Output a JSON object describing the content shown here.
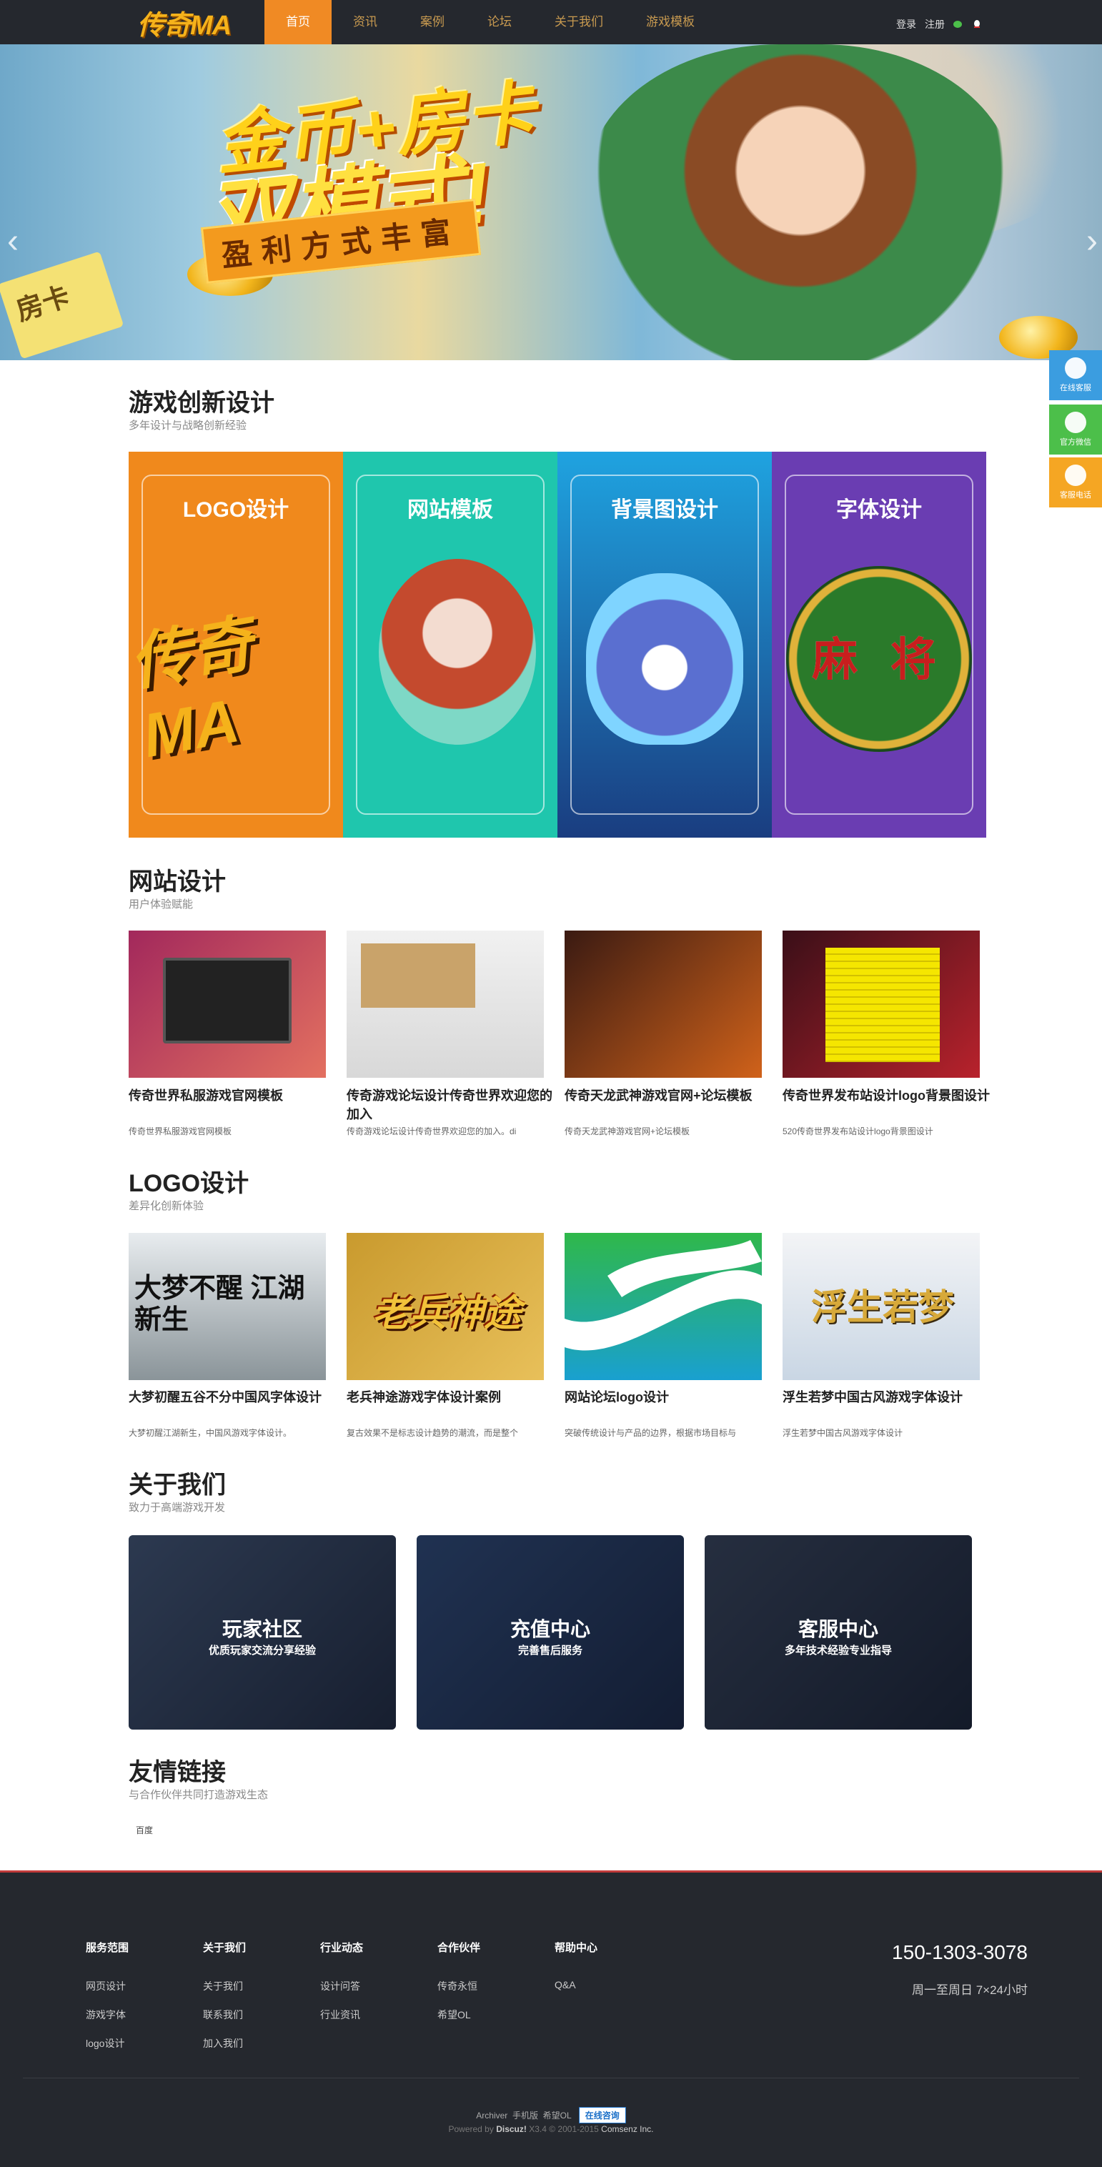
{
  "header": {
    "logo": "传奇MA",
    "nav": [
      "首页",
      "资讯",
      "案例",
      "论坛",
      "关于我们",
      "游戏模板"
    ],
    "login": "登录",
    "register": "注册"
  },
  "banner": {
    "line1": "金币+房卡",
    "line2": "双模式!",
    "line3": "盈利方式丰富",
    "card": "房卡"
  },
  "section1": {
    "title": "游戏创新设计",
    "subtitle": "多年设计与战略创新经验",
    "panels": [
      {
        "label": "LOGO设计",
        "color": "#f0891c",
        "inner": "传奇MA"
      },
      {
        "label": "网站模板",
        "color": "#1fc6ad",
        "inner": ""
      },
      {
        "label": "背景图设计",
        "color": "#1a76c8",
        "inner": ""
      },
      {
        "label": "字体设计",
        "color": "#6a3db2",
        "inner": "麻 将"
      }
    ]
  },
  "section2": {
    "title": "网站设计",
    "subtitle": "用户体验赋能",
    "items": [
      {
        "title": "传奇世界私服游戏官网模板",
        "desc": "传奇世界私服游戏官网模板",
        "bg": "linear-gradient(135deg,#a2285c,#e37060)"
      },
      {
        "title": "传奇游戏论坛设计传奇世界欢迎您的加入",
        "desc": "传奇游戏论坛设计传奇世界欢迎您的加入。di",
        "bg": "linear-gradient(180deg,#f1f1f1,#d8d8d8)"
      },
      {
        "title": "传奇天龙武神游戏官网+论坛模板",
        "desc": "传奇天龙武神游戏官网+论坛模板",
        "bg": "linear-gradient(135deg,#3a1a12,#d0621a)"
      },
      {
        "title": "传奇世界发布站设计logo背景图设计",
        "desc": "520传奇世界发布站设计logo背景图设计",
        "bg": "linear-gradient(135deg,#3a0f18,#b8222c)"
      }
    ]
  },
  "section3": {
    "title": "LOGO设计",
    "subtitle": "差异化创新体验",
    "items": [
      {
        "title": "大梦初醒五谷不分中国风字体设计",
        "desc": "大梦初醒江湖新生，中国风游戏字体设计。",
        "bg": "linear-gradient(180deg,#e8ecef,#8a9499)",
        "img": "大梦不醒 江湖新生"
      },
      {
        "title": "老兵神途游戏字体设计案例",
        "desc": "复古效果不是标志设计趋势的潮流，而是整个",
        "bg": "linear-gradient(135deg,#c99a2e,#e8c05a)",
        "img": "老兵神途"
      },
      {
        "title": "网站论坛logo设计",
        "desc": "突破传统设计与产品的边界，根据市场目标与",
        "bg": "linear-gradient(180deg,#2fb84a,#19a0d0)",
        "img": ""
      },
      {
        "title": "浮生若梦中国古风游戏字体设计",
        "desc": "浮生若梦中国古风游戏字体设计",
        "bg": "linear-gradient(180deg,#f3f4f6,#c9d6e4)",
        "img": "浮生若梦"
      }
    ]
  },
  "section4": {
    "title": "关于我们",
    "subtitle": "致力于高端游戏开发",
    "items": [
      {
        "title": "玩家社区",
        "sub": "优质玩家交流分享经验",
        "bg": "linear-gradient(135deg,#4a5e7a,#1c2433)"
      },
      {
        "title": "充值中心",
        "sub": "完善售后服务",
        "bg": "linear-gradient(135deg,#2f4e7e,#13203a)"
      },
      {
        "title": "客服中心",
        "sub": "多年技术经验专业指导",
        "bg": "linear-gradient(135deg,#3c4656,#141a24)"
      }
    ]
  },
  "section5": {
    "title": "友情链接",
    "subtitle": "与合作伙伴共同打造游戏生态",
    "links": [
      "百度"
    ]
  },
  "sidebar": [
    "在线客服",
    "官方微信",
    "客服电话"
  ],
  "footer": {
    "cols": [
      {
        "head": "服务范围",
        "items": [
          "网页设计",
          "游戏字体",
          "logo设计"
        ]
      },
      {
        "head": "关于我们",
        "items": [
          "关于我们",
          "联系我们",
          "加入我们"
        ]
      },
      {
        "head": "行业动态",
        "items": [
          "设计问答",
          "行业资讯"
        ]
      },
      {
        "head": "合作伙伴",
        "items": [
          "传奇永恒",
          "希望OL"
        ]
      },
      {
        "head": "帮助中心",
        "items": [
          "Q&A"
        ]
      }
    ],
    "phone": "150-1303-3078",
    "hours": "周一至周日 7×24小时",
    "links": [
      "Archiver",
      "手机版",
      "希望OL"
    ],
    "badge": "在线咨询",
    "powered": "Powered by",
    "discuz": "Discuz!",
    "ver": "X3.4",
    "copy": "© 2001-2015",
    "comsenz": "Comsenz Inc."
  },
  "colors": {
    "accent": "#f08a24",
    "dark": "#25282e",
    "side": "#f5a623"
  }
}
